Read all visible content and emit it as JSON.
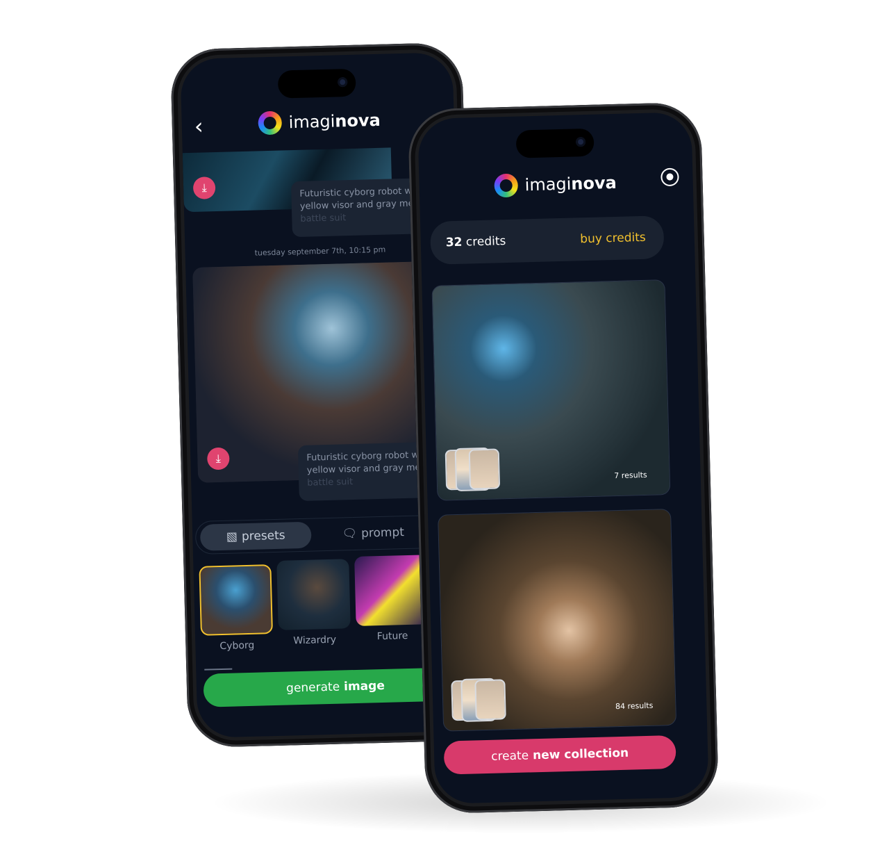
{
  "brand": {
    "name_light": "imagi",
    "name_bold": "nova"
  },
  "left_phone": {
    "back_icon": "chevron-left",
    "messages": [
      {
        "prompt_line1": "Futuristic cyborg robot w",
        "prompt_line2": "yellow visor and gray me",
        "prompt_line3": "battle suit"
      },
      {
        "prompt_line1": "Futuristic cyborg robot w",
        "prompt_line2": "yellow visor and gray me",
        "prompt_line3": "battle suit"
      }
    ],
    "timestamp": "tuesday september 7th, 10:15 pm",
    "tabs": [
      {
        "label": "presets",
        "icon": "image-icon",
        "active": true
      },
      {
        "label": "prompt",
        "icon": "chat-icon",
        "active": false
      }
    ],
    "presets": [
      {
        "label": "Cyborg",
        "selected": true
      },
      {
        "label": "Wizardry"
      },
      {
        "label": "Future"
      }
    ],
    "generate": {
      "light": "generate",
      "bold": "image"
    }
  },
  "right_phone": {
    "profile_icon": "user-circle",
    "credits": {
      "count": "32",
      "label": "credits",
      "buy": "buy credits"
    },
    "collections": [
      {
        "results": "7 results"
      },
      {
        "results": "84 results"
      }
    ],
    "create": {
      "light": "create",
      "bold": "new collection"
    }
  },
  "colors": {
    "accent_green": "#27a84a",
    "accent_pink": "#d83a6b",
    "accent_yellow": "#f2c12e",
    "background": "#0a1120"
  }
}
